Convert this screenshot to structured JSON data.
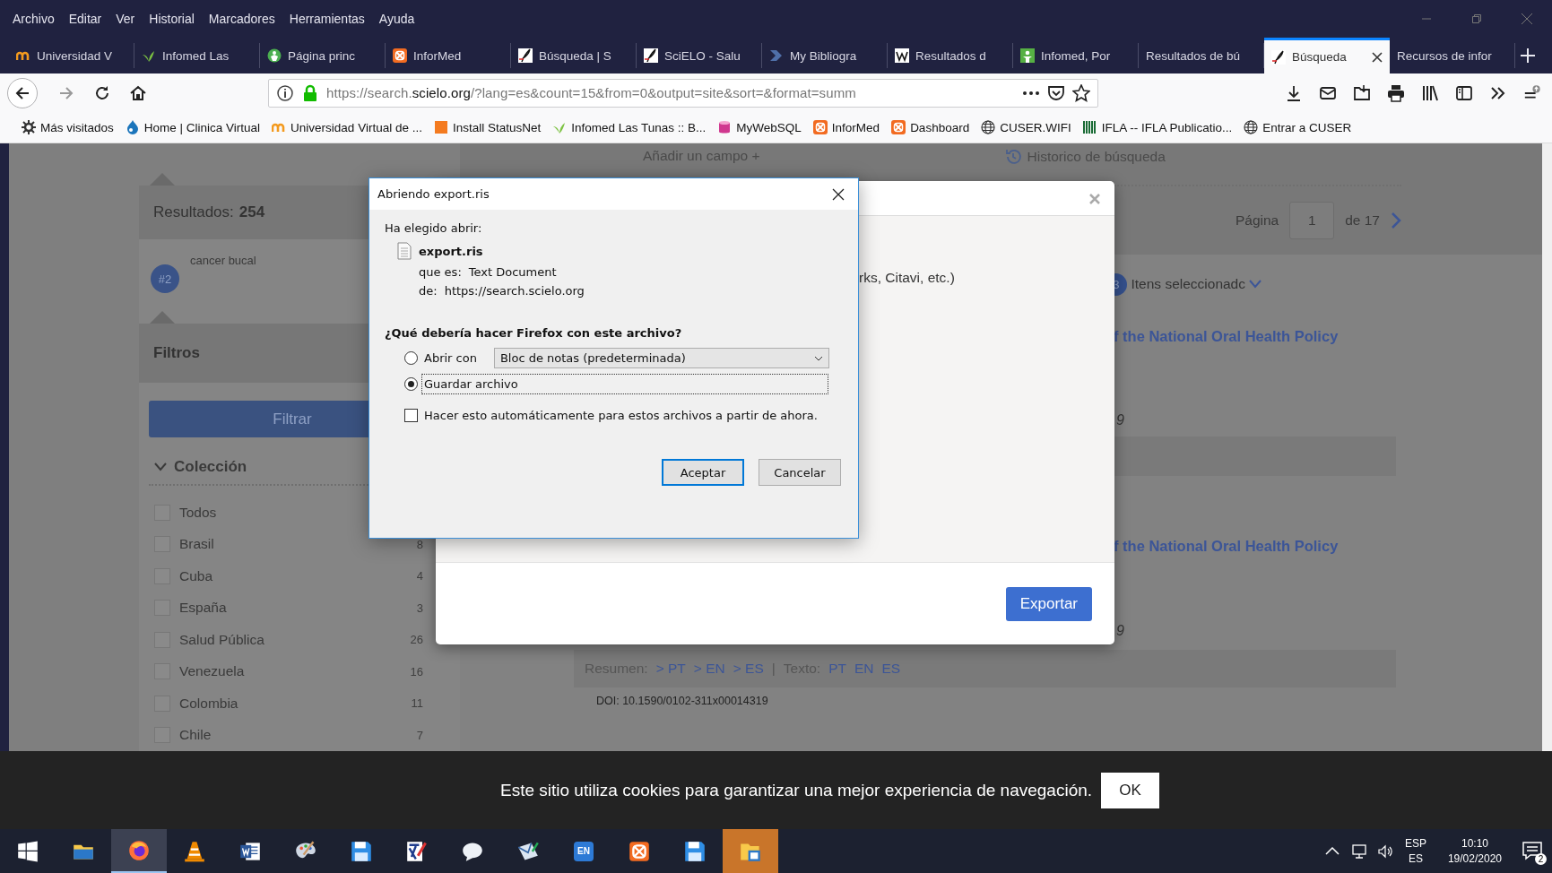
{
  "menu": [
    "Archivo",
    "Editar",
    "Ver",
    "Historial",
    "Marcadores",
    "Herramientas",
    "Ayuda"
  ],
  "tabs": [
    {
      "label": "Universidad V",
      "kind": "arches",
      "selected": false
    },
    {
      "label": "Infomed Las",
      "kind": "leaf",
      "selected": false
    },
    {
      "label": "Página princ",
      "kind": "emblem",
      "selected": false
    },
    {
      "label": "InforMed",
      "kind": "tile",
      "selected": false
    },
    {
      "label": "Búsqueda | S",
      "kind": "quill",
      "selected": false
    },
    {
      "label": "SciELO - Salu",
      "kind": "quill",
      "selected": false
    },
    {
      "label": "My Bibliogra",
      "kind": "chevron",
      "selected": false
    },
    {
      "label": "Resultados d",
      "kind": "wsquare",
      "selected": false
    },
    {
      "label": "Infomed, Por",
      "kind": "person",
      "selected": false
    },
    {
      "label": "Resultados de bú",
      "kind": "none",
      "selected": false
    },
    {
      "label": "Búsqueda",
      "kind": "quill",
      "selected": true
    },
    {
      "label": "Recursos de infor",
      "kind": "none",
      "selected": false
    }
  ],
  "url": {
    "prefix": "https://search.",
    "domain": "scielo.org",
    "rest": "/?lang=es&count=15&from=0&output=site&sort=&format=summ"
  },
  "bookmarks": [
    {
      "label": "Más visitados",
      "kind": "gear"
    },
    {
      "label": "Home | Clinica Virtual",
      "kind": "drop"
    },
    {
      "label": "Universidad Virtual de ...",
      "kind": "arches"
    },
    {
      "label": "Install StatusNet",
      "kind": "square"
    },
    {
      "label": "Infomed Las Tunas :: B...",
      "kind": "leaf"
    },
    {
      "label": "MyWebSQL",
      "kind": "cylinder"
    },
    {
      "label": "InforMed",
      "kind": "tile"
    },
    {
      "label": "Dashboard",
      "kind": "tile"
    },
    {
      "label": "CUSER.WIFI",
      "kind": "globe"
    },
    {
      "label": "IFLA -- IFLA Publicatio...",
      "kind": "bars"
    },
    {
      "label": "Entrar a CUSER",
      "kind": "globe"
    }
  ],
  "page": {
    "add_field": "Añadir un campo +",
    "history": "Historico de búsqueda",
    "results_label": "Resultados:",
    "results_count": "254",
    "query": {
      "number": "#2",
      "text": "cancer bucal"
    },
    "filters_title": "Filtros",
    "filter_button": "Filtrar",
    "collection_title": "Colección",
    "collection": [
      {
        "label": "Todos",
        "checked": false
      },
      {
        "label": "Brasil",
        "count": "8",
        "checked": false
      },
      {
        "label": "Cuba",
        "count": "4",
        "checked": false
      },
      {
        "label": "España",
        "count": "3",
        "checked": false
      },
      {
        "label": "Salud Pública",
        "count": "26",
        "checked": false
      },
      {
        "label": "Venezuela",
        "count": "16",
        "checked": false
      },
      {
        "label": "Colombia",
        "count": "11",
        "checked": false
      },
      {
        "label": "Chile",
        "count": "7",
        "checked": false
      }
    ],
    "pagination": {
      "label": "Página",
      "value": "1",
      "total": "de 17"
    },
    "selected_items": {
      "count": "3",
      "label": "Itens seleccionadc"
    },
    "results": [
      {
        "title": "f the National Oral Health Policy",
        "fragment": "9"
      },
      {
        "title": "f the National Oral Health Policy",
        "fragment": "9"
      }
    ],
    "links_row": {
      "abstract_label": "Resumen:",
      "abstract_links": [
        "> PT",
        "> EN",
        "> ES"
      ],
      "separator": "|",
      "text_label": "Texto:",
      "text_links": [
        "PT",
        "EN",
        "ES"
      ]
    },
    "doi": "DOI: 10.1590/0102-311x00014319"
  },
  "export_modal": {
    "fragment": "rks, Citavi, etc.)",
    "button": "Exportar"
  },
  "download_dialog": {
    "title": "Abriendo export.ris",
    "intro": "Ha elegido abrir:",
    "filename": "export.ris",
    "type_label": "que es:",
    "type": "Text Document",
    "from_label": "de:",
    "from": "https://search.scielo.org",
    "question": "¿Qué debería hacer Firefox con este archivo?",
    "options": [
      {
        "label": "Abrir con",
        "selected": false,
        "dropdown": "Bloc de notas (predeterminada)"
      },
      {
        "label": "Guardar archivo",
        "selected": true
      }
    ],
    "remember": {
      "label": "Hacer esto automáticamente para estos archivos a partir de ahora.",
      "checked": false
    },
    "buttons": [
      "Aceptar",
      "Cancelar"
    ]
  },
  "cookie": {
    "text": "Este sitio utiliza cookies para garantizar una mejor experiencia de navegación.",
    "button": "OK"
  },
  "taskbar": {
    "apps": [
      {
        "kind": "start",
        "active": false,
        "flashing": false
      },
      {
        "kind": "folder",
        "active": false,
        "flashing": false
      },
      {
        "kind": "browser",
        "active": true,
        "flashing": false
      },
      {
        "kind": "cone",
        "active": false,
        "flashing": false
      },
      {
        "kind": "word",
        "active": false,
        "flashing": false
      },
      {
        "kind": "palette",
        "active": false,
        "flashing": false
      },
      {
        "kind": "floppy",
        "active": false,
        "flashing": false
      },
      {
        "kind": "pen",
        "active": false,
        "flashing": false
      },
      {
        "kind": "chat",
        "active": false,
        "flashing": false
      },
      {
        "kind": "mail",
        "active": false,
        "flashing": false
      },
      {
        "kind": "lang",
        "label": "EN",
        "active": false,
        "flashing": false
      },
      {
        "kind": "tile",
        "active": false,
        "flashing": false
      },
      {
        "kind": "floppy",
        "active": false,
        "flashing": false
      },
      {
        "kind": "files",
        "active": false,
        "flashing": true
      }
    ],
    "lang_top": "ESP",
    "lang_bottom": "ES",
    "time": "10:10",
    "date": "19/02/2020",
    "notifications": "2"
  }
}
